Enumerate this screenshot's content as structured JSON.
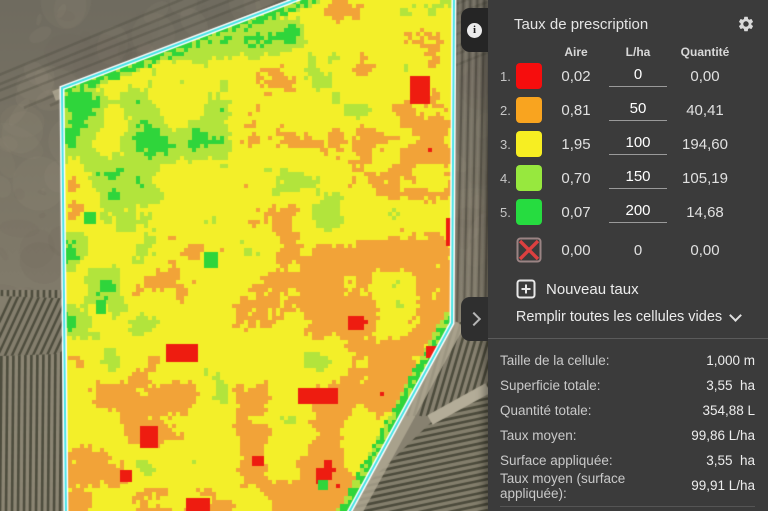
{
  "panel": {
    "title": "Taux de prescription",
    "columns": {
      "aire": "Aire",
      "rate": "L/ha",
      "quantity": "Quantité"
    },
    "rows": [
      {
        "index": "1.",
        "color": "#f60d0d",
        "aire": "0,02",
        "rate": "0",
        "quantity": "0,00"
      },
      {
        "index": "2.",
        "color": "#f9a41f",
        "aire": "0,81",
        "rate": "50",
        "quantity": "40,41"
      },
      {
        "index": "3.",
        "color": "#f7ee22",
        "aire": "1,95",
        "rate": "100",
        "quantity": "194,60"
      },
      {
        "index": "4.",
        "color": "#97e83e",
        "aire": "0,70",
        "rate": "150",
        "quantity": "105,19"
      },
      {
        "index": "5.",
        "color": "#26dc40",
        "aire": "0,07",
        "rate": "200",
        "quantity": "14,68"
      }
    ],
    "empty_row": {
      "aire": "0,00",
      "rate": "0",
      "quantity": "0,00"
    },
    "new_rate_label": "Nouveau taux",
    "fill_empty_label": "Remplir toutes les cellules vides",
    "stats": [
      {
        "label": "Taille de la cellule:",
        "value": "1,000 m"
      },
      {
        "label": "Superficie totale:",
        "value": "3,55  ha"
      },
      {
        "label": "Quantité totale:",
        "value": "354,88 L"
      },
      {
        "label": "Taux moyen:",
        "value": "99,86 L/ha"
      },
      {
        "label": "Surface appliquée:",
        "value": "3,55  ha"
      },
      {
        "label": "Taux moyen (surface appliquée):",
        "value": "99,91 L/ha"
      }
    ]
  },
  "icons": {
    "settings": "gear-icon",
    "info_letter": "i",
    "collapse": "chevron-right-icon",
    "new_rate": "plus-square-icon",
    "fill_empty": "chevron-down-icon",
    "empty_swatch": "crossed-cell-icon"
  },
  "map": {
    "border_outer": "#ffffff",
    "border_inner": "#45e2e4",
    "class_colors": [
      "#ee1c10",
      "#f2a338",
      "#f3ef29",
      "#b2e43c",
      "#2fd53b"
    ]
  }
}
